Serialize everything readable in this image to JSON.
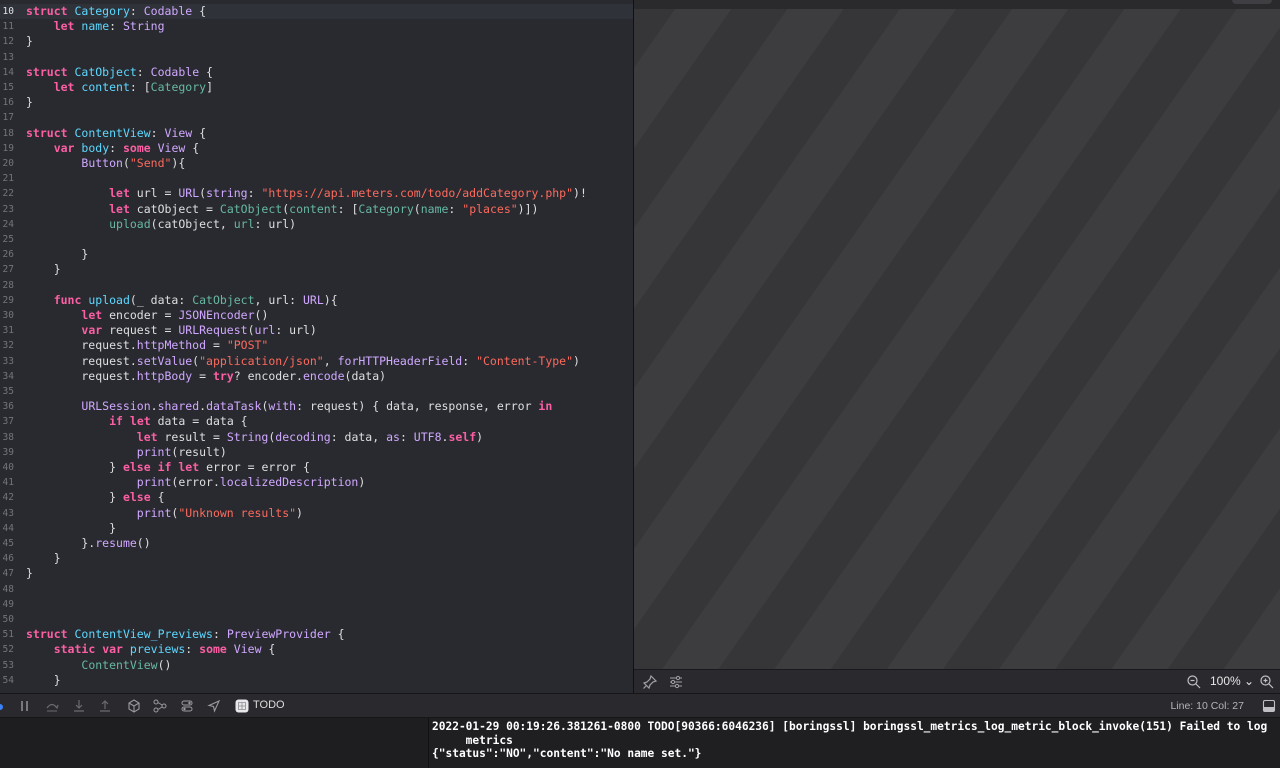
{
  "editor": {
    "current_line": "10",
    "lines": [
      {
        "n": "10",
        "tokens": [
          {
            "t": "kw",
            "v": "struct"
          },
          {
            "t": "pl",
            "v": " "
          },
          {
            "t": "ty",
            "v": "Category"
          },
          {
            "t": "pl",
            "v": ": "
          },
          {
            "t": "ty2",
            "v": "Codable"
          },
          {
            "t": "pl",
            "v": " {"
          }
        ]
      },
      {
        "n": "11",
        "tokens": [
          {
            "t": "pl",
            "v": "    "
          },
          {
            "t": "kw",
            "v": "let"
          },
          {
            "t": "pl",
            "v": " "
          },
          {
            "t": "ty",
            "v": "name"
          },
          {
            "t": "pl",
            "v": ": "
          },
          {
            "t": "ty2",
            "v": "String"
          }
        ]
      },
      {
        "n": "12",
        "tokens": [
          {
            "t": "pl",
            "v": "}"
          }
        ]
      },
      {
        "n": "13",
        "tokens": []
      },
      {
        "n": "14",
        "tokens": [
          {
            "t": "kw",
            "v": "struct"
          },
          {
            "t": "pl",
            "v": " "
          },
          {
            "t": "ty",
            "v": "CatObject"
          },
          {
            "t": "pl",
            "v": ": "
          },
          {
            "t": "ty2",
            "v": "Codable"
          },
          {
            "t": "pl",
            "v": " {"
          }
        ]
      },
      {
        "n": "15",
        "tokens": [
          {
            "t": "pl",
            "v": "    "
          },
          {
            "t": "kw",
            "v": "let"
          },
          {
            "t": "pl",
            "v": " "
          },
          {
            "t": "ty",
            "v": "content"
          },
          {
            "t": "pl",
            "v": ": ["
          },
          {
            "t": "fn",
            "v": "Category"
          },
          {
            "t": "pl",
            "v": "]"
          }
        ]
      },
      {
        "n": "16",
        "tokens": [
          {
            "t": "pl",
            "v": "}"
          }
        ]
      },
      {
        "n": "17",
        "tokens": []
      },
      {
        "n": "18",
        "tokens": [
          {
            "t": "kw",
            "v": "struct"
          },
          {
            "t": "pl",
            "v": " "
          },
          {
            "t": "ty",
            "v": "ContentView"
          },
          {
            "t": "pl",
            "v": ": "
          },
          {
            "t": "ty2",
            "v": "View"
          },
          {
            "t": "pl",
            "v": " {"
          }
        ]
      },
      {
        "n": "19",
        "tokens": [
          {
            "t": "pl",
            "v": "    "
          },
          {
            "t": "kw",
            "v": "var"
          },
          {
            "t": "pl",
            "v": " "
          },
          {
            "t": "ty",
            "v": "body"
          },
          {
            "t": "pl",
            "v": ": "
          },
          {
            "t": "kw",
            "v": "some"
          },
          {
            "t": "pl",
            "v": " "
          },
          {
            "t": "ty2",
            "v": "View"
          },
          {
            "t": "pl",
            "v": " {"
          }
        ]
      },
      {
        "n": "20",
        "tokens": [
          {
            "t": "pl",
            "v": "        "
          },
          {
            "t": "ty2",
            "v": "Button"
          },
          {
            "t": "pl",
            "v": "("
          },
          {
            "t": "st",
            "v": "\"Send\""
          },
          {
            "t": "pl",
            "v": "){"
          }
        ]
      },
      {
        "n": "21",
        "tokens": []
      },
      {
        "n": "22",
        "tokens": [
          {
            "t": "pl",
            "v": "            "
          },
          {
            "t": "kw",
            "v": "let"
          },
          {
            "t": "pl",
            "v": " url = "
          },
          {
            "t": "ty2",
            "v": "URL"
          },
          {
            "t": "pl",
            "v": "("
          },
          {
            "t": "ty2",
            "v": "string"
          },
          {
            "t": "pl",
            "v": ": "
          },
          {
            "t": "st",
            "v": "\"https://api.meters.com/todo/addCategory.php\""
          },
          {
            "t": "pl",
            "v": ")!"
          }
        ]
      },
      {
        "n": "23",
        "tokens": [
          {
            "t": "pl",
            "v": "            "
          },
          {
            "t": "kw",
            "v": "let"
          },
          {
            "t": "pl",
            "v": " catObject = "
          },
          {
            "t": "fn",
            "v": "CatObject"
          },
          {
            "t": "pl",
            "v": "("
          },
          {
            "t": "fn",
            "v": "content"
          },
          {
            "t": "pl",
            "v": ": ["
          },
          {
            "t": "fn",
            "v": "Category"
          },
          {
            "t": "pl",
            "v": "("
          },
          {
            "t": "fn",
            "v": "name"
          },
          {
            "t": "pl",
            "v": ": "
          },
          {
            "t": "st",
            "v": "\"places\""
          },
          {
            "t": "pl",
            "v": ")])"
          }
        ]
      },
      {
        "n": "24",
        "tokens": [
          {
            "t": "pl",
            "v": "            "
          },
          {
            "t": "fn",
            "v": "upload"
          },
          {
            "t": "pl",
            "v": "(catObject, "
          },
          {
            "t": "fn",
            "v": "url"
          },
          {
            "t": "pl",
            "v": ": url)"
          }
        ]
      },
      {
        "n": "25",
        "tokens": []
      },
      {
        "n": "26",
        "tokens": [
          {
            "t": "pl",
            "v": "        }"
          }
        ]
      },
      {
        "n": "27",
        "tokens": [
          {
            "t": "pl",
            "v": "    }"
          }
        ]
      },
      {
        "n": "28",
        "tokens": []
      },
      {
        "n": "29",
        "tokens": [
          {
            "t": "pl",
            "v": "    "
          },
          {
            "t": "kw",
            "v": "func"
          },
          {
            "t": "pl",
            "v": " "
          },
          {
            "t": "ty",
            "v": "upload"
          },
          {
            "t": "pl",
            "v": "(_ data: "
          },
          {
            "t": "fn",
            "v": "CatObject"
          },
          {
            "t": "pl",
            "v": ", url: "
          },
          {
            "t": "ty2",
            "v": "URL"
          },
          {
            "t": "pl",
            "v": "){"
          }
        ]
      },
      {
        "n": "30",
        "tokens": [
          {
            "t": "pl",
            "v": "        "
          },
          {
            "t": "kw",
            "v": "let"
          },
          {
            "t": "pl",
            "v": " encoder = "
          },
          {
            "t": "ty2",
            "v": "JSONEncoder"
          },
          {
            "t": "pl",
            "v": "()"
          }
        ]
      },
      {
        "n": "31",
        "tokens": [
          {
            "t": "pl",
            "v": "        "
          },
          {
            "t": "kw",
            "v": "var"
          },
          {
            "t": "pl",
            "v": " request = "
          },
          {
            "t": "ty2",
            "v": "URLRequest"
          },
          {
            "t": "pl",
            "v": "("
          },
          {
            "t": "ty2",
            "v": "url"
          },
          {
            "t": "pl",
            "v": ": url)"
          }
        ]
      },
      {
        "n": "32",
        "tokens": [
          {
            "t": "pl",
            "v": "        request."
          },
          {
            "t": "ty2",
            "v": "httpMethod"
          },
          {
            "t": "pl",
            "v": " = "
          },
          {
            "t": "st",
            "v": "\"POST\""
          }
        ]
      },
      {
        "n": "33",
        "tokens": [
          {
            "t": "pl",
            "v": "        request."
          },
          {
            "t": "ty2",
            "v": "setValue"
          },
          {
            "t": "pl",
            "v": "("
          },
          {
            "t": "st",
            "v": "\"application/json\""
          },
          {
            "t": "pl",
            "v": ", "
          },
          {
            "t": "ty2",
            "v": "forHTTPHeaderField"
          },
          {
            "t": "pl",
            "v": ": "
          },
          {
            "t": "st",
            "v": "\"Content-Type\""
          },
          {
            "t": "pl",
            "v": ")"
          }
        ]
      },
      {
        "n": "34",
        "tokens": [
          {
            "t": "pl",
            "v": "        request."
          },
          {
            "t": "ty2",
            "v": "httpBody"
          },
          {
            "t": "pl",
            "v": " = "
          },
          {
            "t": "kw",
            "v": "try"
          },
          {
            "t": "pl",
            "v": "? encoder."
          },
          {
            "t": "ty2",
            "v": "encode"
          },
          {
            "t": "pl",
            "v": "(data)"
          }
        ]
      },
      {
        "n": "35",
        "tokens": []
      },
      {
        "n": "36",
        "tokens": [
          {
            "t": "pl",
            "v": "        "
          },
          {
            "t": "ty2",
            "v": "URLSession"
          },
          {
            "t": "pl",
            "v": "."
          },
          {
            "t": "ty2",
            "v": "shared"
          },
          {
            "t": "pl",
            "v": "."
          },
          {
            "t": "ty2",
            "v": "dataTask"
          },
          {
            "t": "pl",
            "v": "("
          },
          {
            "t": "ty2",
            "v": "with"
          },
          {
            "t": "pl",
            "v": ": request) { data, response, error "
          },
          {
            "t": "kw",
            "v": "in"
          }
        ]
      },
      {
        "n": "37",
        "tokens": [
          {
            "t": "pl",
            "v": "            "
          },
          {
            "t": "kw",
            "v": "if"
          },
          {
            "t": "pl",
            "v": " "
          },
          {
            "t": "kw",
            "v": "let"
          },
          {
            "t": "pl",
            "v": " data = data {"
          }
        ]
      },
      {
        "n": "38",
        "tokens": [
          {
            "t": "pl",
            "v": "                "
          },
          {
            "t": "kw",
            "v": "let"
          },
          {
            "t": "pl",
            "v": " result = "
          },
          {
            "t": "ty2",
            "v": "String"
          },
          {
            "t": "pl",
            "v": "("
          },
          {
            "t": "ty2",
            "v": "decoding"
          },
          {
            "t": "pl",
            "v": ": data, "
          },
          {
            "t": "ty2",
            "v": "as"
          },
          {
            "t": "pl",
            "v": ": "
          },
          {
            "t": "ty2",
            "v": "UTF8"
          },
          {
            "t": "pl",
            "v": "."
          },
          {
            "t": "kw",
            "v": "self"
          },
          {
            "t": "pl",
            "v": ")"
          }
        ]
      },
      {
        "n": "39",
        "tokens": [
          {
            "t": "pl",
            "v": "                "
          },
          {
            "t": "ty2",
            "v": "print"
          },
          {
            "t": "pl",
            "v": "(result)"
          }
        ]
      },
      {
        "n": "40",
        "tokens": [
          {
            "t": "pl",
            "v": "            } "
          },
          {
            "t": "kw",
            "v": "else"
          },
          {
            "t": "pl",
            "v": " "
          },
          {
            "t": "kw",
            "v": "if"
          },
          {
            "t": "pl",
            "v": " "
          },
          {
            "t": "kw",
            "v": "let"
          },
          {
            "t": "pl",
            "v": " error = error {"
          }
        ]
      },
      {
        "n": "41",
        "tokens": [
          {
            "t": "pl",
            "v": "                "
          },
          {
            "t": "ty2",
            "v": "print"
          },
          {
            "t": "pl",
            "v": "(error."
          },
          {
            "t": "ty2",
            "v": "localizedDescription"
          },
          {
            "t": "pl",
            "v": ")"
          }
        ]
      },
      {
        "n": "42",
        "tokens": [
          {
            "t": "pl",
            "v": "            } "
          },
          {
            "t": "kw",
            "v": "else"
          },
          {
            "t": "pl",
            "v": " {"
          }
        ]
      },
      {
        "n": "43",
        "tokens": [
          {
            "t": "pl",
            "v": "                "
          },
          {
            "t": "ty2",
            "v": "print"
          },
          {
            "t": "pl",
            "v": "("
          },
          {
            "t": "st",
            "v": "\"Unknown results\""
          },
          {
            "t": "pl",
            "v": ")"
          }
        ]
      },
      {
        "n": "44",
        "tokens": [
          {
            "t": "pl",
            "v": "            }"
          }
        ]
      },
      {
        "n": "45",
        "tokens": [
          {
            "t": "pl",
            "v": "        }."
          },
          {
            "t": "ty2",
            "v": "resume"
          },
          {
            "t": "pl",
            "v": "()"
          }
        ]
      },
      {
        "n": "46",
        "tokens": [
          {
            "t": "pl",
            "v": "    }"
          }
        ]
      },
      {
        "n": "47",
        "tokens": [
          {
            "t": "pl",
            "v": "}"
          }
        ]
      },
      {
        "n": "48",
        "tokens": []
      },
      {
        "n": "49",
        "tokens": []
      },
      {
        "n": "50",
        "tokens": []
      },
      {
        "n": "51",
        "tokens": [
          {
            "t": "kw",
            "v": "struct"
          },
          {
            "t": "pl",
            "v": " "
          },
          {
            "t": "ty",
            "v": "ContentView_Previews"
          },
          {
            "t": "pl",
            "v": ": "
          },
          {
            "t": "ty2",
            "v": "PreviewProvider"
          },
          {
            "t": "pl",
            "v": " {"
          }
        ]
      },
      {
        "n": "52",
        "tokens": [
          {
            "t": "pl",
            "v": "    "
          },
          {
            "t": "kw",
            "v": "static"
          },
          {
            "t": "pl",
            "v": " "
          },
          {
            "t": "kw",
            "v": "var"
          },
          {
            "t": "pl",
            "v": " "
          },
          {
            "t": "ty",
            "v": "previews"
          },
          {
            "t": "pl",
            "v": ": "
          },
          {
            "t": "kw",
            "v": "some"
          },
          {
            "t": "pl",
            "v": " "
          },
          {
            "t": "ty2",
            "v": "View"
          },
          {
            "t": "pl",
            "v": " {"
          }
        ]
      },
      {
        "n": "53",
        "tokens": [
          {
            "t": "pl",
            "v": "        "
          },
          {
            "t": "fn",
            "v": "ContentView"
          },
          {
            "t": "pl",
            "v": "()"
          }
        ]
      },
      {
        "n": "54",
        "tokens": [
          {
            "t": "pl",
            "v": "    }"
          }
        ]
      }
    ]
  },
  "canvas": {
    "zoom": "100%",
    "pin_icon": "pin-icon",
    "settings_icon": "sliders-icon",
    "zoom_out_icon": "zoom-out-icon",
    "zoom_in_icon": "zoom-in-icon"
  },
  "debug_bar": {
    "scheme_name": "TODO",
    "line_col": "Line: 10  Col: 27",
    "icons": [
      "pause-icon",
      "step-over-icon",
      "step-into-icon",
      "step-out-icon",
      "debug-view-hierarchy-icon",
      "memory-graph-icon",
      "environment-overrides-icon",
      "location-icon",
      "app-icon",
      "console-toggle-icon"
    ]
  },
  "console": {
    "lines": [
      "2022-01-29 00:19:26.381261-0800 TODO[90366:6046236] [boringssl] boringssl_metrics_log_metric_block_invoke(151) Failed to log",
      "     metrics",
      "{\"status\":\"NO\",\"content\":\"No name set.\"}"
    ]
  },
  "colors": {
    "editor_bg": "#292a30",
    "keyword": "#fc5fa3",
    "type_decl": "#5dd8ff",
    "type_ref": "#d0a8ff",
    "project_ref": "#67b7a4",
    "string": "#fc6a5d",
    "plain": "#dfdfe0"
  }
}
